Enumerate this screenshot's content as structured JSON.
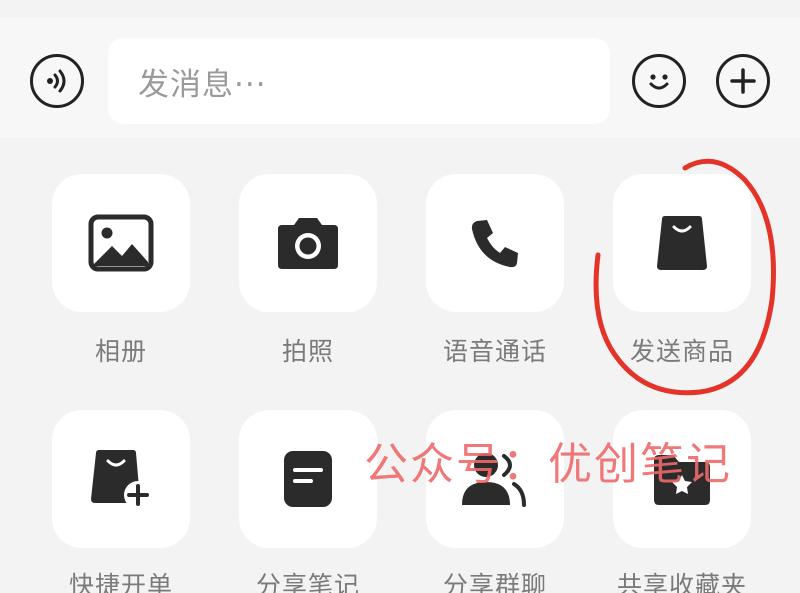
{
  "input_bar": {
    "placeholder": "发消息···",
    "voice_icon": "voice-wave-icon",
    "emoji_icon": "smiley-icon",
    "plus_icon": "plus-icon"
  },
  "actions": [
    {
      "label": "相册",
      "icon": "photo-icon"
    },
    {
      "label": "拍照",
      "icon": "camera-icon"
    },
    {
      "label": "语音通话",
      "icon": "phone-icon"
    },
    {
      "label": "发送商品",
      "icon": "shopping-bag-icon"
    },
    {
      "label": "快捷开单",
      "icon": "bag-add-icon"
    },
    {
      "label": "分享笔记",
      "icon": "note-icon"
    },
    {
      "label": "分享群聊",
      "icon": "group-chat-icon"
    },
    {
      "label": "共享收藏夹",
      "icon": "starred-folder-icon"
    }
  ],
  "watermark": "公众号：优创笔记",
  "colors": {
    "background": "#f3f3f3",
    "tile": "#ffffff",
    "icon": "#2b2b2b",
    "label": "#7a7a7a",
    "annotation": "#e4342a",
    "watermark": "#ef6a6a"
  }
}
